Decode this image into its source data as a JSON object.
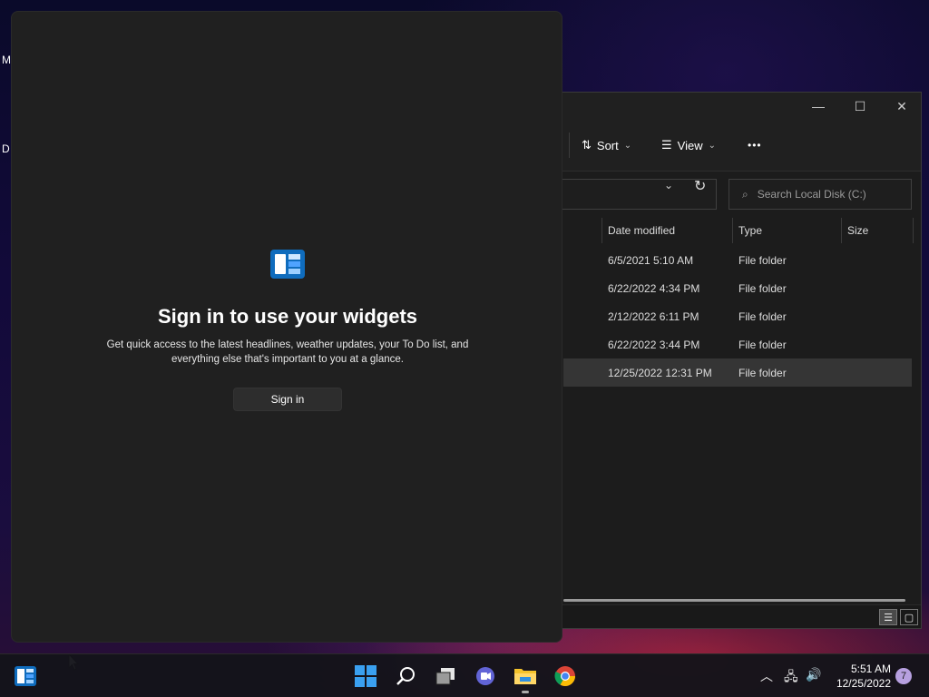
{
  "desktop": {
    "icon_letters": [
      "M",
      "D"
    ]
  },
  "explorer": {
    "window_controls": {
      "minimize": "—",
      "maximize": "☐",
      "close": "✕"
    },
    "toolbar": {
      "sort_label": "Sort",
      "view_label": "View",
      "more_label": "•••"
    },
    "search": {
      "placeholder": "Search Local Disk (C:)"
    },
    "columns": [
      "Date modified",
      "Type",
      "Size"
    ],
    "rows": [
      {
        "date": "6/5/2021 5:10 AM",
        "type": "File folder",
        "size": ""
      },
      {
        "date": "6/22/2022 4:34 PM",
        "type": "File folder",
        "size": ""
      },
      {
        "date": "2/12/2022 6:11 PM",
        "type": "File folder",
        "size": ""
      },
      {
        "date": "6/22/2022 3:44 PM",
        "type": "File folder",
        "size": ""
      },
      {
        "date": "12/25/2022 12:31 PM",
        "type": "File folder",
        "size": "",
        "selected": true
      }
    ]
  },
  "widgets": {
    "title": "Sign in to use your widgets",
    "description": "Get quick access to the latest headlines, weather updates, your To Do list, and everything else that's important to you at a glance.",
    "signin_label": "Sign in",
    "accent": "#0f6cbd"
  },
  "taskbar": {
    "clock": {
      "time": "5:51 AM",
      "date": "12/25/2022"
    },
    "notification_count": "7",
    "apps": [
      "widgets-icon",
      "start-icon",
      "search-icon",
      "task-view-icon",
      "teams-chat-icon",
      "file-explorer-icon",
      "chrome-icon"
    ]
  }
}
